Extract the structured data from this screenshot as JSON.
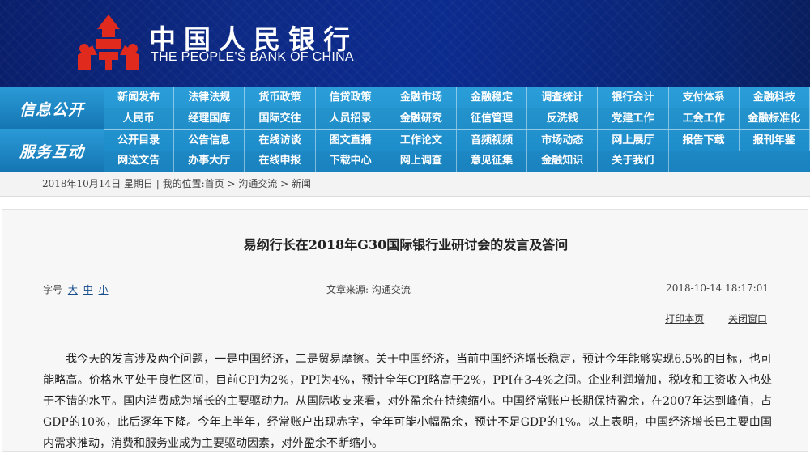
{
  "header": {
    "title_cn": "中国人民银行",
    "title_en": "THE PEOPLE'S BANK OF CHINA",
    "logo_icon": "pboc-logo-icon",
    "logo_color": "#e02a1e"
  },
  "nav": {
    "block1_label": "信息公开",
    "block2_label": "服务互动",
    "rows": [
      [
        "新闻发布",
        "法律法规",
        "货币政策",
        "信贷政策",
        "金融市场",
        "金融稳定",
        "调查统计",
        "银行会计",
        "支付体系",
        "金融科技"
      ],
      [
        "人民币",
        "经理国库",
        "国际交往",
        "人员招录",
        "金融研究",
        "征信管理",
        "反洗钱",
        "党建工作",
        "工会工作",
        "金融标准化"
      ],
      [
        "公开目录",
        "公告信息",
        "在线访谈",
        "图文直播",
        "工作论文",
        "音频视频",
        "市场动态",
        "网上展厅",
        "报告下载",
        "报刊年鉴"
      ],
      [
        "网送文告",
        "办事大厅",
        "在线申报",
        "下载中心",
        "网上调查",
        "意见征集",
        "金融知识",
        "关于我们",
        "",
        ""
      ]
    ]
  },
  "breadcrumb": {
    "date": "2018年10月14日 星期日",
    "location_prefix": "我的位置:",
    "items": [
      "首页",
      "沟通交流",
      "新闻"
    ]
  },
  "article": {
    "title": "易纲行长在2018年G30国际银行业研讨会的发言及答问",
    "font_size_label": "字号",
    "font_sizes": [
      "大",
      "中",
      "小"
    ],
    "source_label": "文章来源:",
    "source": "沟通交流",
    "datetime": "2018-10-14 18:17:01",
    "print_label": "打印本页",
    "close_label": "关闭窗口",
    "paragraph": "我今天的发言涉及两个问题，一是中国经济，二是贸易摩擦。关于中国经济，当前中国经济增长稳定，预计今年能够实现6.5%的目标，也可能略高。价格水平处于良性区间，目前CPI为2%，PPI为4%，预计全年CPI略高于2%，PPI在3-4%之间。企业利润增加，税收和工资收入也处于不错的水平。国内消费成为增长的主要驱动力。从国际收支来看，对外盈余在持续缩小。中国经常账户长期保持盈余，在2007年达到峰值，占GDP的10%，此后逐年下降。今年上半年，经常账户出现赤字，全年可能小幅盈余，预计不足GDP的1%。以上表明，中国经济增长已主要由国内需求推动，消费和服务业成为主要驱动因素，对外盈余不断缩小。"
  }
}
